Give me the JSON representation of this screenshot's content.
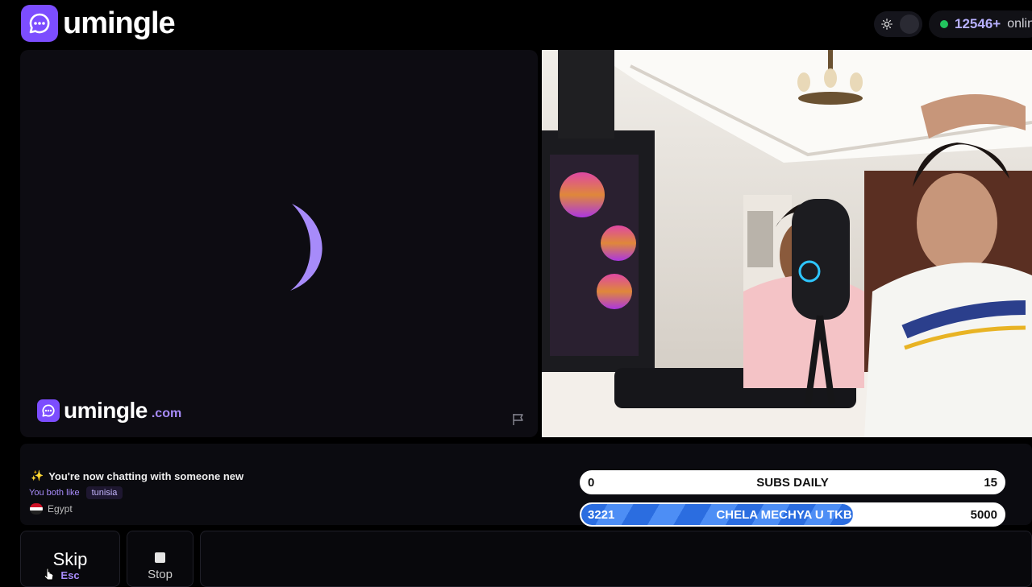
{
  "header": {
    "logo_text": "umingle",
    "online_count": "12546+",
    "online_label": "online"
  },
  "stranger": {
    "watermark_name": "umingle",
    "watermark_tld": ".com",
    "status": "loading"
  },
  "chat": {
    "messages": [
      {
        "emoji": "✨",
        "text": "You're now chatting with someone new"
      }
    ],
    "common_interest_label": "You both like",
    "common_interest": "tunisia",
    "partner_country": "Egypt"
  },
  "goals": [
    {
      "left": "0",
      "title": "SUBS DAILY",
      "right": "15",
      "progress": 0
    },
    {
      "left": "3221",
      "title": "CHELA MECHYA U TKBER",
      "right": "5000",
      "progress": 0.644
    }
  ],
  "controls": {
    "skip_label": "Skip",
    "skip_key": "Esc",
    "stop_label": "Stop"
  },
  "colors": {
    "brand": "#7c4dff",
    "online_dot": "#22c55e",
    "goal_fill": "#2b6de0"
  }
}
